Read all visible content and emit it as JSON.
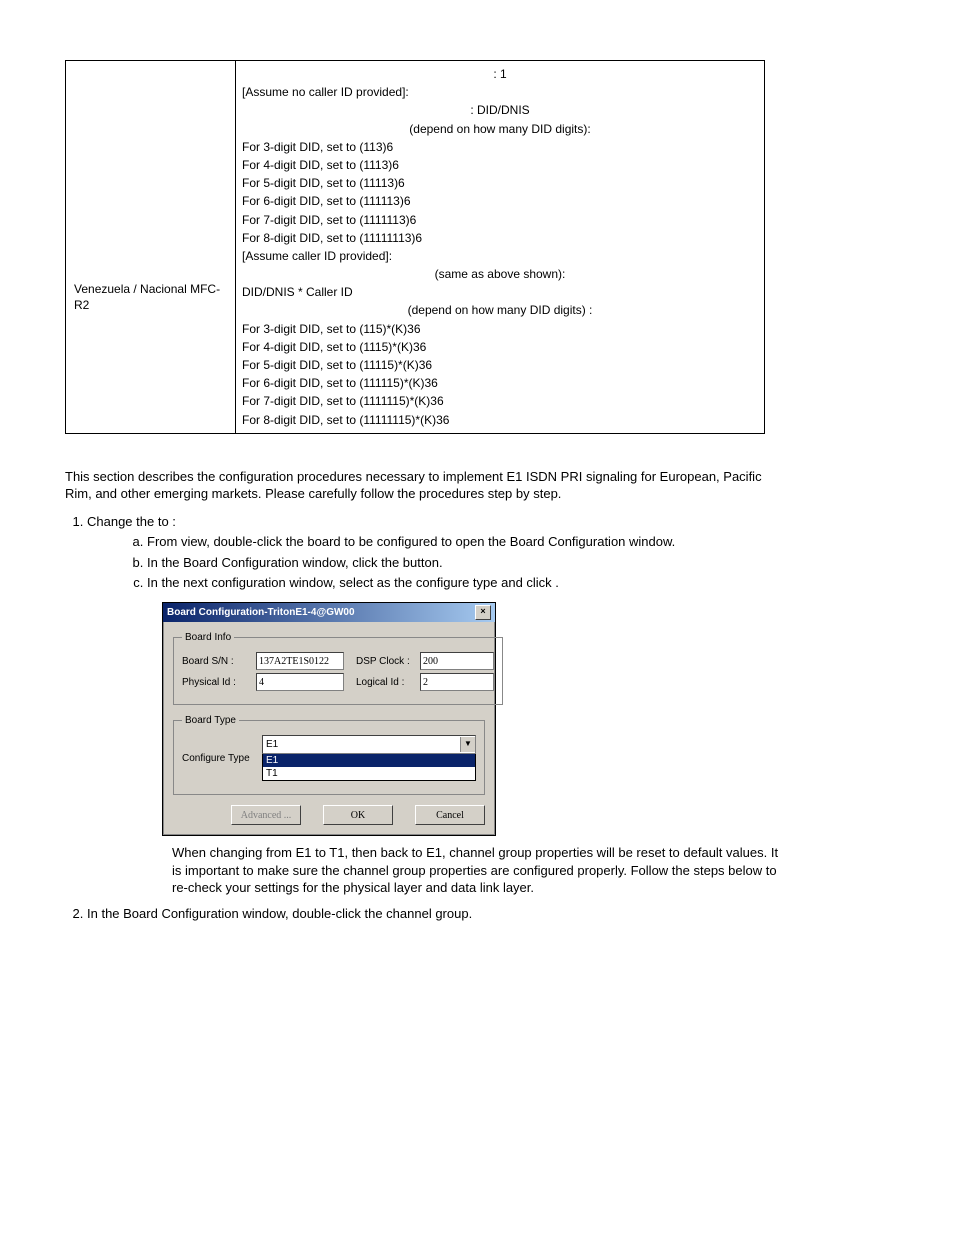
{
  "table": {
    "leftCell": "Venezuela / Nacional MFC-R2",
    "lines": [
      {
        "cls": "center",
        "t": ": 1"
      },
      {
        "cls": "",
        "t": "[Assume no caller ID provided]:"
      },
      {
        "cls": "center",
        "t": ": DID/DNIS"
      },
      {
        "cls": "center",
        "t": "(depend on how many DID digits):"
      },
      {
        "cls": "",
        "t": "For 3-digit DID, set to (113)6"
      },
      {
        "cls": "",
        "t": "For 4-digit DID, set to (1113)6"
      },
      {
        "cls": "",
        "t": "For 5-digit DID, set to (11113)6"
      },
      {
        "cls": "",
        "t": "For 6-digit DID, set to (111113)6"
      },
      {
        "cls": "",
        "t": "For 7-digit DID, set to (1111113)6"
      },
      {
        "cls": "",
        "t": "For 8-digit DID, set to (11111113)6"
      },
      {
        "cls": "",
        "t": "[Assume caller ID provided]:"
      },
      {
        "cls": "center",
        "t": "(same as above shown):"
      },
      {
        "cls": "",
        "t": "DID/DNIS *  Caller ID"
      },
      {
        "cls": "center",
        "t": "(depend on how many DID digits) :"
      },
      {
        "cls": "",
        "t": "For 3-digit DID, set to (115)*(K)36"
      },
      {
        "cls": "",
        "t": "For 4-digit DID, set to (1115)*(K)36"
      },
      {
        "cls": "",
        "t": "For 5-digit DID, set to (11115)*(K)36"
      },
      {
        "cls": "",
        "t": "For 6-digit DID, set to (111115)*(K)36"
      },
      {
        "cls": "",
        "t": "For 7-digit DID, set to (1111115)*(K)36"
      },
      {
        "cls": "",
        "t": "For 8-digit DID, set to (11111115)*(K)36"
      }
    ]
  },
  "section": {
    "intro": "This section describes the configuration procedures necessary to implement E1 ISDN PRI signaling for European, Pacific Rim, and other emerging markets. Please carefully follow the procedures step by step.",
    "step1": "Change the                        to      :",
    "step1a": "From               view, double-click the board to be configured to open the Board Configuration window.",
    "step1b": "In the Board Configuration window, click the                                       button.",
    "step1c": "In the next configuration window, select       as the configure type and click       .",
    "note": "When changing from E1 to T1, then back to E1, channel group properties will be reset to default values. It is important to make sure the channel group properties are configured properly. Follow the steps below to re-check your settings for the physical layer and data link layer.",
    "step2": "In the Board Configuration window, double-click the channel group."
  },
  "dialog": {
    "title": "Board Configuration-TritonE1-4@GW00",
    "group1": "Board Info",
    "lbl_sn": "Board S/N :",
    "val_sn": "137A2TE1S0122",
    "lbl_dsp": "DSP Clock :",
    "val_dsp": "200",
    "lbl_pid": "Physical Id :",
    "val_pid": "4",
    "lbl_lid": "Logical Id :",
    "val_lid": "2",
    "group2": "Board Type",
    "lbl_cfg": "Configure Type",
    "sel_val": "E1",
    "opt1": "E1",
    "opt2": "T1",
    "btn_adv": "Advanced ...",
    "btn_ok": "OK",
    "btn_cancel": "Cancel"
  }
}
